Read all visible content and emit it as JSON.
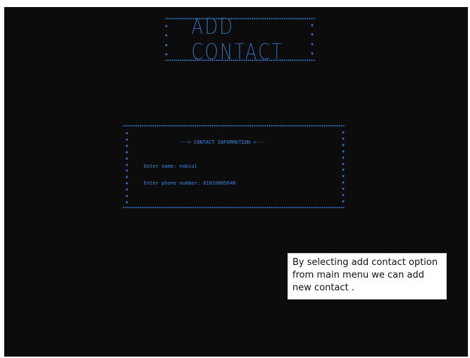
{
  "header": {
    "title": "ADD CONTACT"
  },
  "contact_form": {
    "section_title": "---> CONTACT INFORMATION <---",
    "name_prompt": "Enter name: ",
    "name_value": "nabiul",
    "phone_prompt": "Enter phone number: ",
    "phone_value": "01816805646"
  },
  "callout": {
    "lines": [
      "By selecting add contact option",
      "from main menu we can add",
      "new contact ."
    ]
  },
  "colors": {
    "console_bg": "#0c0c0c",
    "console_text": "#3f86e0",
    "border_dots": "#3a7bd5"
  }
}
